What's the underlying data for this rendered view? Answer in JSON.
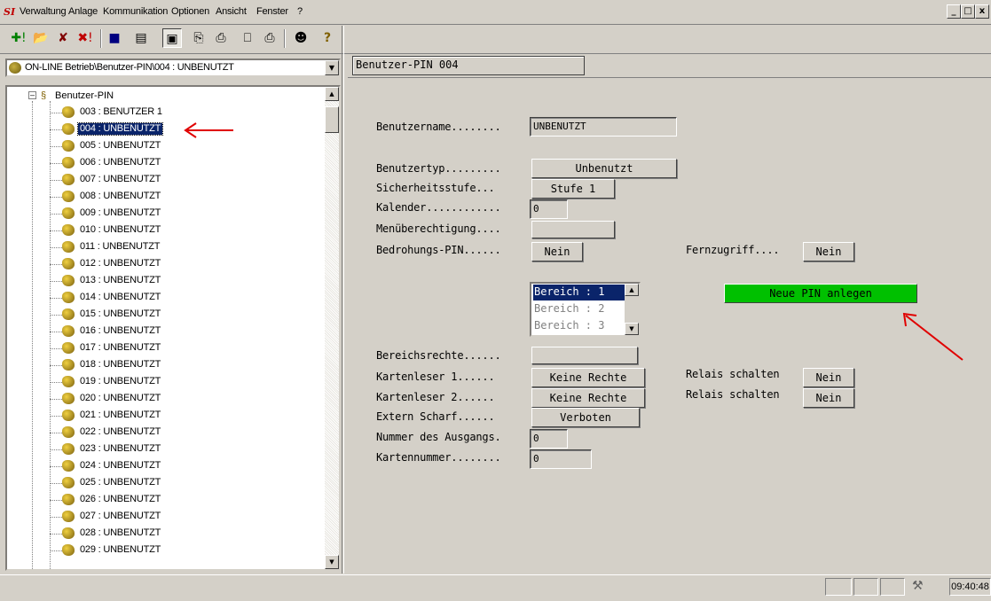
{
  "app": {
    "icon_label": "SI",
    "menu": [
      "Verwaltung",
      "Anlage",
      "Kommunikation",
      "Optionen",
      "Ansicht",
      "Fenster",
      "?"
    ],
    "window_controls": [
      "_",
      "□",
      "x"
    ]
  },
  "toolbar": {
    "buttons": [
      {
        "name": "new",
        "glyph": "✚!"
      },
      {
        "name": "open",
        "glyph": "📂"
      },
      {
        "name": "delete",
        "glyph": "✘"
      },
      {
        "name": "delete-all",
        "glyph": "✖!"
      },
      {
        "name": "save",
        "glyph": "■"
      },
      {
        "name": "properties",
        "glyph": "▤"
      },
      {
        "name": "image",
        "glyph": "▣"
      },
      {
        "name": "copy",
        "glyph": "⎘"
      },
      {
        "name": "paste",
        "glyph": "⎙"
      },
      {
        "name": "preview",
        "glyph": "⎕"
      },
      {
        "name": "print",
        "glyph": "⎙"
      },
      {
        "name": "user",
        "glyph": "☻"
      },
      {
        "name": "help",
        "glyph": "?"
      }
    ]
  },
  "path": "ON-LINE Betrieb\\Benutzer-PIN\\004 : UNBENUTZT",
  "tree": {
    "root": "Benutzer-PIN",
    "items": [
      "003 : BENUTZER 1",
      "004 : UNBENUTZT",
      "005 : UNBENUTZT",
      "006 : UNBENUTZT",
      "007 : UNBENUTZT",
      "008 : UNBENUTZT",
      "009 : UNBENUTZT",
      "010 : UNBENUTZT",
      "011 : UNBENUTZT",
      "012 : UNBENUTZT",
      "013 : UNBENUTZT",
      "014 : UNBENUTZT",
      "015 : UNBENUTZT",
      "016 : UNBENUTZT",
      "017 : UNBENUTZT",
      "018 : UNBENUTZT",
      "019 : UNBENUTZT",
      "020 : UNBENUTZT",
      "021 : UNBENUTZT",
      "022 : UNBENUTZT",
      "023 : UNBENUTZT",
      "024 : UNBENUTZT",
      "025 : UNBENUTZT",
      "026 : UNBENUTZT",
      "027 : UNBENUTZT",
      "028 : UNBENUTZT",
      "029 : UNBENUTZT"
    ],
    "selected_index": 1
  },
  "form": {
    "header": "Benutzer-PIN 004",
    "benutzername_label": "Benutzername........",
    "benutzername_value": "UNBENUTZT",
    "benutzertyp_label": "Benutzertyp.........",
    "benutzertyp_value": "Unbenutzt",
    "sicherheitsstufe_label": "Sicherheitsstufe...",
    "sicherheitsstufe_value": "Stufe 1",
    "kalender_label": "Kalender............",
    "kalender_value": "0",
    "menue_label": "Menüberechtigung....",
    "bedrohung_label": "Bedrohungs-PIN......",
    "bedrohung_value": "Nein",
    "fernzugriff_label": "Fernzugriff....",
    "fernzugriff_value": "Nein",
    "bereiche": [
      "Bereich : 1",
      "Bereich : 2",
      "Bereich : 3"
    ],
    "neue_pin_label": "Neue PIN anlegen",
    "bereichsrechte_label": "Bereichsrechte......",
    "kartenleser1_label": "Kartenleser 1......",
    "kartenleser1_value": "Keine Rechte",
    "kartenleser2_label": "Kartenleser 2......",
    "kartenleser2_value": "Keine Rechte",
    "relais1_label": "Relais schalten",
    "relais1_value": "Nein",
    "relais2_label": "Relais schalten",
    "relais2_value": "Nein",
    "extern_label": "Extern Scharf......",
    "extern_value": "Verboten",
    "ausgang_label": "Nummer des Ausgangs.",
    "ausgang_value": "0",
    "kartennummer_label": "Kartennummer........",
    "kartennummer_value": "0"
  },
  "status": {
    "time": "09:40:48"
  },
  "colors": {
    "accent_green": "#00c000",
    "selection": "#0a246a",
    "annotation_arrow": "#e00000"
  }
}
